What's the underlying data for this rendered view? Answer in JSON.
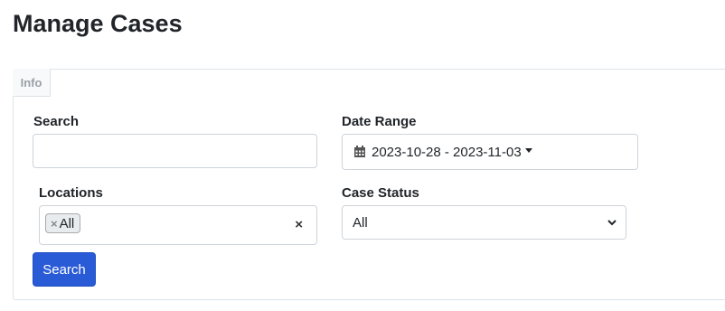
{
  "page": {
    "title": "Manage Cases"
  },
  "panel": {
    "tab_label": "Info"
  },
  "search": {
    "label": "Search",
    "value": "",
    "placeholder": ""
  },
  "date_range": {
    "label": "Date Range",
    "value": "2023-10-28 - 2023-11-03",
    "icon": "calendar-icon"
  },
  "locations": {
    "label": "Locations",
    "selected": [
      "All"
    ],
    "chip_remove": "×",
    "clear": "×"
  },
  "case_status": {
    "label": "Case Status",
    "value": "All"
  },
  "search_button": {
    "label": "Search"
  },
  "colors": {
    "button_bg": "#2a5bd7",
    "border": "#ced4da"
  }
}
